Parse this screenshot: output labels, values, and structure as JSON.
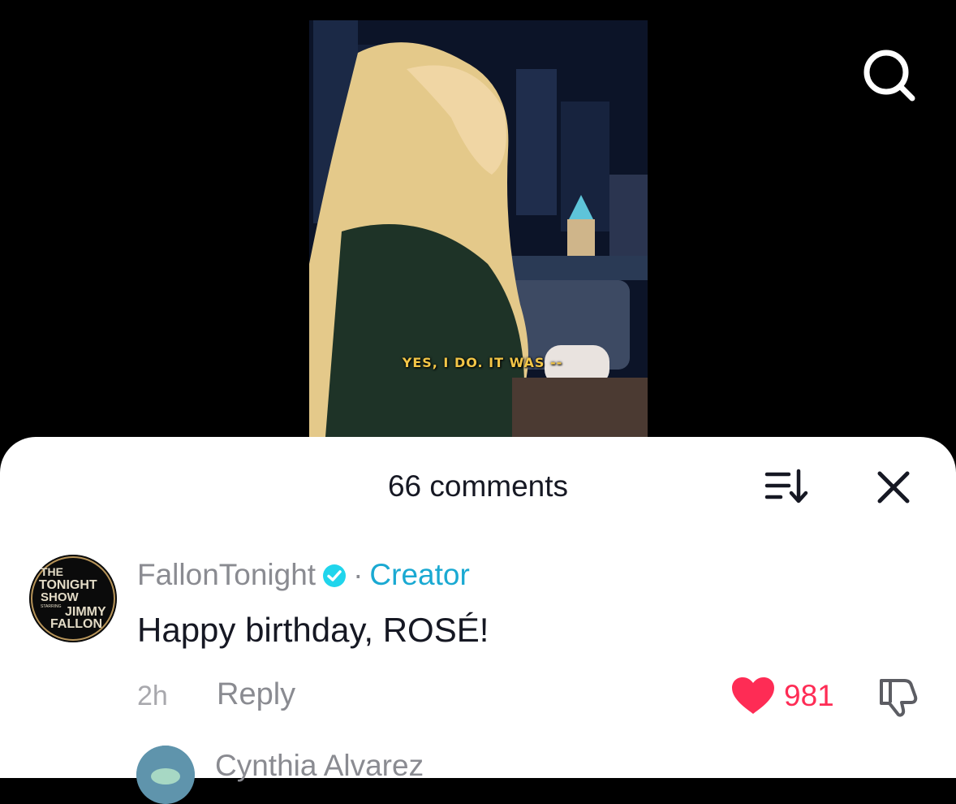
{
  "video": {
    "subtitle": "YES, I DO. IT WAS --"
  },
  "top_bar": {
    "search_icon": "search-icon"
  },
  "comments_sheet": {
    "title": "66 comments",
    "sort_icon": "sort-icon",
    "close_icon": "close-icon",
    "comments": [
      {
        "avatar_icon": "tonight-show-logo",
        "author": "FallonTonight",
        "verified": true,
        "separator": "·",
        "tag": "Creator",
        "text": "Happy birthday, ROSÉ!",
        "time": "2h",
        "reply_label": "Reply",
        "likes": "981",
        "liked": true
      },
      {
        "author": "Cynthia Alvarez"
      }
    ]
  },
  "colors": {
    "accent_like": "#fe2c55",
    "creator_tag": "#1aa9d2",
    "verified_badge": "#20d5ec"
  }
}
